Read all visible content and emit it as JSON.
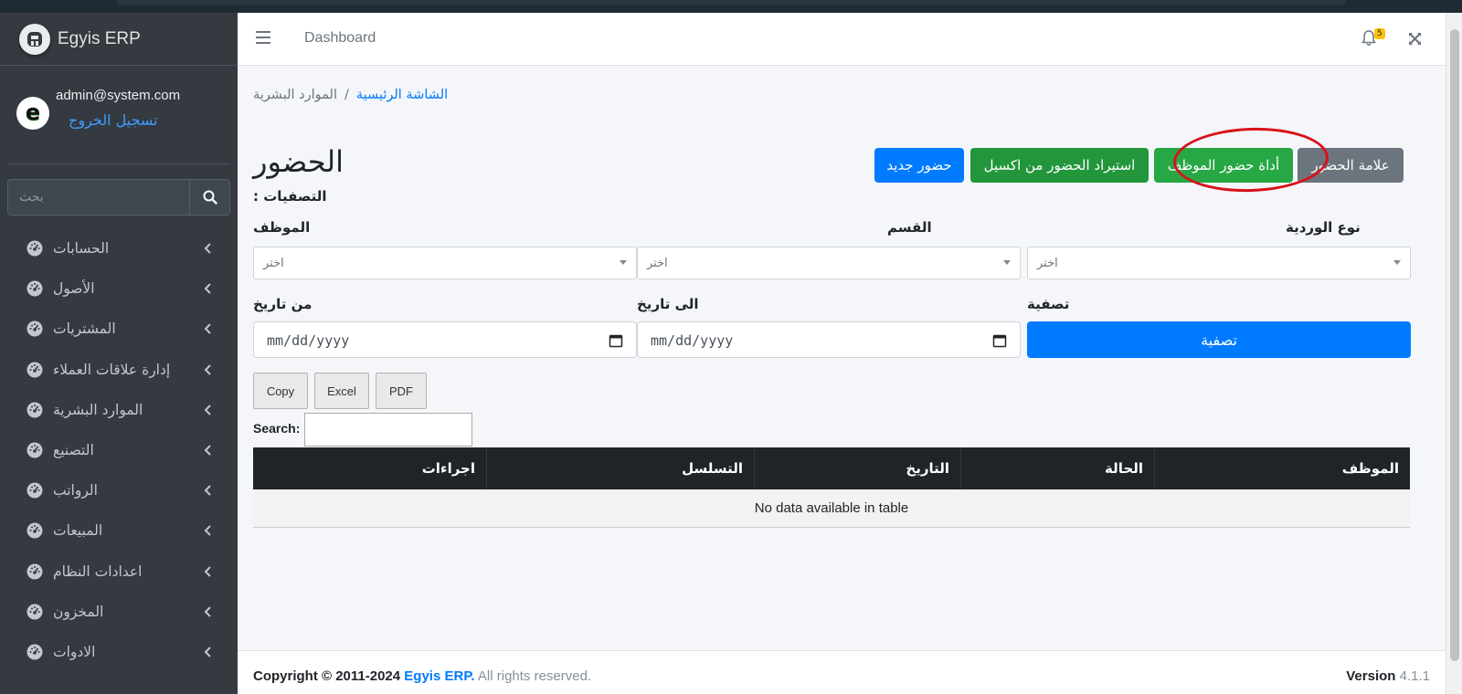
{
  "app": {
    "brand": "Egyis ERP",
    "user_email": "admin@system.com",
    "logout_label": "تسجيل الخروج"
  },
  "sidebar": {
    "search_placeholder": "بحث",
    "items": [
      {
        "label": "الحسابات"
      },
      {
        "label": "الأصول"
      },
      {
        "label": "المشتريات"
      },
      {
        "label": "إدارة علاقات العملاء"
      },
      {
        "label": "الموارد البشرية"
      },
      {
        "label": "التصنيع"
      },
      {
        "label": "الرواتب"
      },
      {
        "label": "المبيعات"
      },
      {
        "label": "اعدادات النظام"
      },
      {
        "label": "المخزون"
      },
      {
        "label": "الادوات"
      }
    ]
  },
  "header": {
    "dashboard_link": "Dashboard",
    "notification_count": "5"
  },
  "breadcrumb": {
    "home": "الشاشة الرئيسية",
    "separator": "/",
    "current": "الموارد البشرية"
  },
  "page": {
    "title": "الحضور",
    "filters_label": ": التصفيات"
  },
  "actions": {
    "mark_attendance": "علامة الحضور",
    "employee_attendance_tool": "أداة حضور الموظف",
    "import_excel": "استيراد الحضور من اكسيل",
    "new_attendance": "حضور جديد"
  },
  "filters": {
    "employee_label": "الموظف",
    "department_label": "القسم",
    "shift_type_label": "نوع الوردية",
    "select_placeholder": "اختر",
    "from_date_label": "من تاريخ",
    "to_date_label": "الى تاريخ",
    "filter_label": "تصفية",
    "date_placeholder": "mm/dd/yyyy",
    "filter_button": "تصفية"
  },
  "datatable": {
    "buttons": [
      "Copy",
      "Excel",
      "PDF"
    ],
    "search_label": "Search:",
    "columns": [
      "الموظف",
      "الحالة",
      "التاريخ",
      "التسلسل",
      "اجراءات"
    ],
    "empty_message": "No data available in table"
  },
  "footer": {
    "copyright_prefix": "Copyright © 2011-2024",
    "company": "Egyis ERP.",
    "rights": "All rights reserved.",
    "version_label": "Version",
    "version": "4.1.1"
  },
  "colors": {
    "sidebar_bg": "#343a40",
    "primary": "#007bff",
    "success": "#28a745",
    "secondary": "#6c757d",
    "highlight": "#d9111a"
  }
}
